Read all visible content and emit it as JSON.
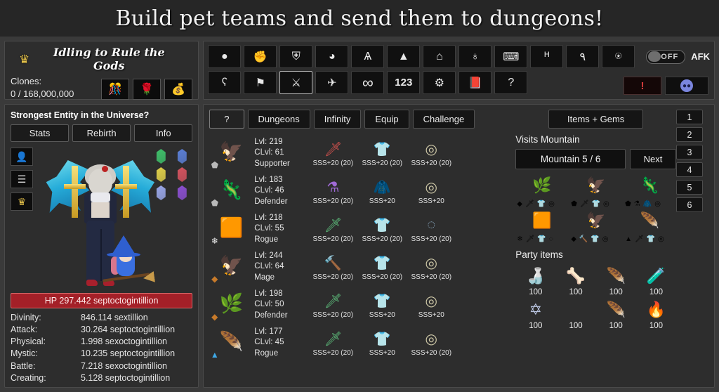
{
  "banner": {
    "text": "Build pet teams and send them to dungeons!"
  },
  "game_header": {
    "crown_icon": "crown-icon",
    "title": "Idling to Rule the Gods",
    "clones_label": "Clones:",
    "clones_value": "0 / 168,000,000",
    "items": [
      {
        "name": "firecracker-item",
        "glyph": "🎊"
      },
      {
        "name": "rose-item",
        "glyph": "🌹"
      },
      {
        "name": "gold-item",
        "glyph": "💰"
      }
    ]
  },
  "toolbar": {
    "row1": [
      {
        "name": "orb-icon",
        "glyph": "●"
      },
      {
        "name": "fist-icon",
        "glyph": "✊"
      },
      {
        "name": "shield-icon",
        "glyph": "⛨"
      },
      {
        "name": "slime-icon",
        "glyph": "◕"
      },
      {
        "name": "creature-icon",
        "glyph": "Ѧ"
      },
      {
        "name": "pyramid-icon",
        "glyph": "▲"
      },
      {
        "name": "building-icon",
        "glyph": "⌂"
      },
      {
        "name": "planet-icon",
        "glyph": "♁"
      },
      {
        "name": "flashlight-icon",
        "glyph": "⌨"
      },
      {
        "name": "bats-icon",
        "glyph": "ᴴ"
      },
      {
        "name": "people-icon",
        "glyph": "٩"
      },
      {
        "name": "ghost-icon",
        "glyph": "⍟"
      }
    ],
    "row2": [
      {
        "name": "cat-icon",
        "glyph": "ʕ"
      },
      {
        "name": "flag-icon",
        "glyph": "⚑"
      },
      {
        "name": "crossed-swords-icon",
        "glyph": "⚔",
        "selected": true
      },
      {
        "name": "bird-icon",
        "glyph": "✈"
      },
      {
        "name": "infinity-icon",
        "glyph": "∞"
      },
      {
        "name": "numbers-icon",
        "glyph": "123"
      },
      {
        "name": "gear-icon",
        "glyph": "⚙"
      },
      {
        "name": "book-icon",
        "glyph": "📕"
      },
      {
        "name": "help-icon",
        "glyph": "?"
      }
    ],
    "afk": {
      "toggle_state": "OFF",
      "label": "AFK"
    },
    "alert_button": "!",
    "discord_button": "discord-icon"
  },
  "character_panel": {
    "entity_title": "Strongest Entity in the Universe?",
    "tabs": [
      {
        "label": "Stats",
        "active": true
      },
      {
        "label": "Rebirth",
        "active": false
      },
      {
        "label": "Info",
        "active": false
      }
    ],
    "side_buttons": [
      {
        "name": "profile-button",
        "glyph": "👤"
      },
      {
        "name": "menu-button",
        "glyph": "☰"
      },
      {
        "name": "crown-button",
        "glyph": "♛"
      }
    ],
    "gems": [
      {
        "name": "green-gem",
        "color": "#3fbf6a"
      },
      {
        "name": "blue-gem",
        "color": "#5b7fd6"
      },
      {
        "name": "yellow-gem",
        "color": "#e0d04a"
      },
      {
        "name": "red-gem",
        "color": "#d4535f"
      },
      {
        "name": "lightblue-gem",
        "color": "#9aa7e8"
      },
      {
        "name": "purple-gem",
        "color": "#8b4fd1"
      }
    ],
    "hp": "HP 297.442 septoctogintillion",
    "hp_color": "#a42028",
    "stats": [
      {
        "label": "Divinity:",
        "value": "846.114 sextillion"
      },
      {
        "label": "Attack:",
        "value": "30.264 septoctogintillion"
      },
      {
        "label": "Physical:",
        "value": "1.998 sexoctogintillion"
      },
      {
        "label": "Mystic:",
        "value": "10.235 septoctogintillion"
      },
      {
        "label": "Battle:",
        "value": "7.218 sexoctogintillion"
      },
      {
        "label": "Creating:",
        "value": "5.128 septoctogintillion"
      }
    ]
  },
  "main": {
    "tabs": [
      {
        "label": "?",
        "active": true
      },
      {
        "label": "Dungeons",
        "active": false
      },
      {
        "label": "Infinity",
        "active": false
      },
      {
        "label": "Equip",
        "active": false
      },
      {
        "label": "Challenge",
        "active": false
      }
    ],
    "pets": [
      {
        "art": "🦅",
        "badge": "⬟",
        "badge_color": "#b9b9b9",
        "level": "Lvl: 219",
        "clevel": "CLvl: 61",
        "role": "Supporter",
        "gear": [
          {
            "name": "weapon-slot",
            "glyph": "🗡",
            "color": "#d9534f",
            "label": "SSS+20  (20)"
          },
          {
            "name": "armor-slot",
            "glyph": "👕",
            "color": "#dcdcdc",
            "label": "SSS+20  (20)"
          },
          {
            "name": "ring-slot",
            "glyph": "◎",
            "color": "#cfc9a8",
            "label": "SSS+20  (20)"
          }
        ]
      },
      {
        "art": "🦎",
        "badge": "⬟",
        "badge_color": "#b9b9b9",
        "level": "Lvl: 183",
        "clevel": "CLvl: 46",
        "role": "Defender",
        "gear": [
          {
            "name": "weapon-slot",
            "glyph": "⚗",
            "color": "#a06ad6",
            "label": "SSS+20  (20)"
          },
          {
            "name": "armor-slot",
            "glyph": "🧥",
            "color": "#dcdcdc",
            "label": "SSS+20"
          },
          {
            "name": "ring-slot",
            "glyph": "◎",
            "color": "#cfc9a8",
            "label": "SSS+20"
          }
        ]
      },
      {
        "art": "🟧",
        "badge": "❄",
        "badge_color": "#e8e8e8",
        "level": "Lvl: 218",
        "clevel": "CLvl: 55",
        "role": "Rogue",
        "gear": [
          {
            "name": "weapon-slot",
            "glyph": "🗡",
            "color": "#5fc27e",
            "label": "SSS+20  (20)"
          },
          {
            "name": "armor-slot",
            "glyph": "👕",
            "color": "#a8a24f",
            "label": "SSS+20  (20)"
          },
          {
            "name": "necklace-slot",
            "glyph": "◌",
            "color": "#8fb0c9",
            "label": "SSS+20  (20)"
          }
        ]
      },
      {
        "art": "🦅",
        "badge": "◆",
        "badge_color": "#c77a2a",
        "level": "Lvl: 244",
        "clevel": "CLvl: 64",
        "role": "Mage",
        "gear": [
          {
            "name": "weapon-slot",
            "glyph": "🔨",
            "color": "#6b5fd0",
            "label": "SSS+20  (20)"
          },
          {
            "name": "armor-slot",
            "glyph": "👕",
            "color": "#a8a24f",
            "label": "SSS+20  (20)"
          },
          {
            "name": "ring-slot",
            "glyph": "◎",
            "color": "#cfc9a8",
            "label": "SSS+20  (20)"
          }
        ]
      },
      {
        "art": "🌿",
        "badge": "◆",
        "badge_color": "#c77a2a",
        "level": "Lvl: 198",
        "clevel": "CLvl: 50",
        "role": "Defender",
        "gear": [
          {
            "name": "weapon-slot",
            "glyph": "🗡",
            "color": "#5fc27e",
            "label": "SSS+20  (20)"
          },
          {
            "name": "armor-slot",
            "glyph": "👕",
            "color": "#a8a24f",
            "label": "SSS+20"
          },
          {
            "name": "ring-slot",
            "glyph": "◎",
            "color": "#cfc9a8",
            "label": "SSS+20"
          }
        ]
      },
      {
        "art": "🪶",
        "badge": "▲",
        "badge_color": "#3fa9e8",
        "level": "Lvl: 177",
        "clevel": "CLvl: 45",
        "role": "Rogue",
        "gear": [
          {
            "name": "weapon-slot",
            "glyph": "🗡",
            "color": "#5fc27e",
            "label": "SSS+20  (20)"
          },
          {
            "name": "armor-slot",
            "glyph": "👕",
            "color": "#a8a24f",
            "label": "SSS+20"
          },
          {
            "name": "ring-slot",
            "glyph": "◎",
            "color": "#cfc9a8",
            "label": "SSS+20  (20)"
          }
        ]
      }
    ]
  },
  "right_panel": {
    "items_gems_button": "Items + Gems",
    "visits_title": "Visits Mountain",
    "mountain_button": "Mountain 5 / 6",
    "next_button": "Next",
    "slot_numbers": [
      "1",
      "2",
      "3",
      "4",
      "5",
      "6"
    ],
    "party_slots": [
      {
        "name": "party-slot-1",
        "art": "🌿",
        "color": "#5fc27e",
        "minis": [
          "◆",
          "🗡",
          "👕",
          "◎"
        ]
      },
      {
        "name": "party-slot-2",
        "art": "🦅",
        "color": "#b59a7a",
        "minis": [
          "⬟",
          "🗡",
          "👕",
          "◎"
        ]
      },
      {
        "name": "party-slot-3",
        "art": "🦎",
        "color": "#5fc27e",
        "minis": [
          "⬟",
          "⚗",
          "🧥",
          "◎"
        ]
      },
      {
        "name": "party-slot-4",
        "art": "🟧",
        "color": "#d4732a",
        "minis": [
          "❄",
          "🗡",
          "👕",
          "◌"
        ]
      },
      {
        "name": "party-slot-5",
        "art": "🦅",
        "color": "#8a7355",
        "minis": [
          "◆",
          "🔨",
          "👕",
          "◎"
        ]
      },
      {
        "name": "party-slot-6",
        "art": "🪶",
        "color": "#b89ae0",
        "minis": [
          "▲",
          "🗡",
          "👕",
          "◎"
        ]
      }
    ],
    "party_items_title": "Party items",
    "party_items": [
      {
        "name": "potion-item",
        "glyph": "🍶",
        "color": "#c9843a",
        "count": "100"
      },
      {
        "name": "bone-item",
        "glyph": "🦴",
        "color": "#e8dcc0",
        "count": "100"
      },
      {
        "name": "feather-item",
        "glyph": "🪶",
        "color": "#d4762a",
        "count": "100"
      },
      {
        "name": "green-vial-item",
        "glyph": "🧪",
        "color": "#6fc94f",
        "count": "100"
      },
      {
        "name": "talisman-item",
        "glyph": "✡",
        "color": "#b9c4e0",
        "count": "100"
      },
      {
        "name": "empty-item",
        "glyph": "",
        "color": "#555555",
        "count": "100"
      },
      {
        "name": "wing-item",
        "glyph": "🪶",
        "color": "#3f6fd8",
        "count": "100"
      },
      {
        "name": "torch-item",
        "glyph": "🔥",
        "color": "#e8832a",
        "count": "100"
      }
    ]
  }
}
